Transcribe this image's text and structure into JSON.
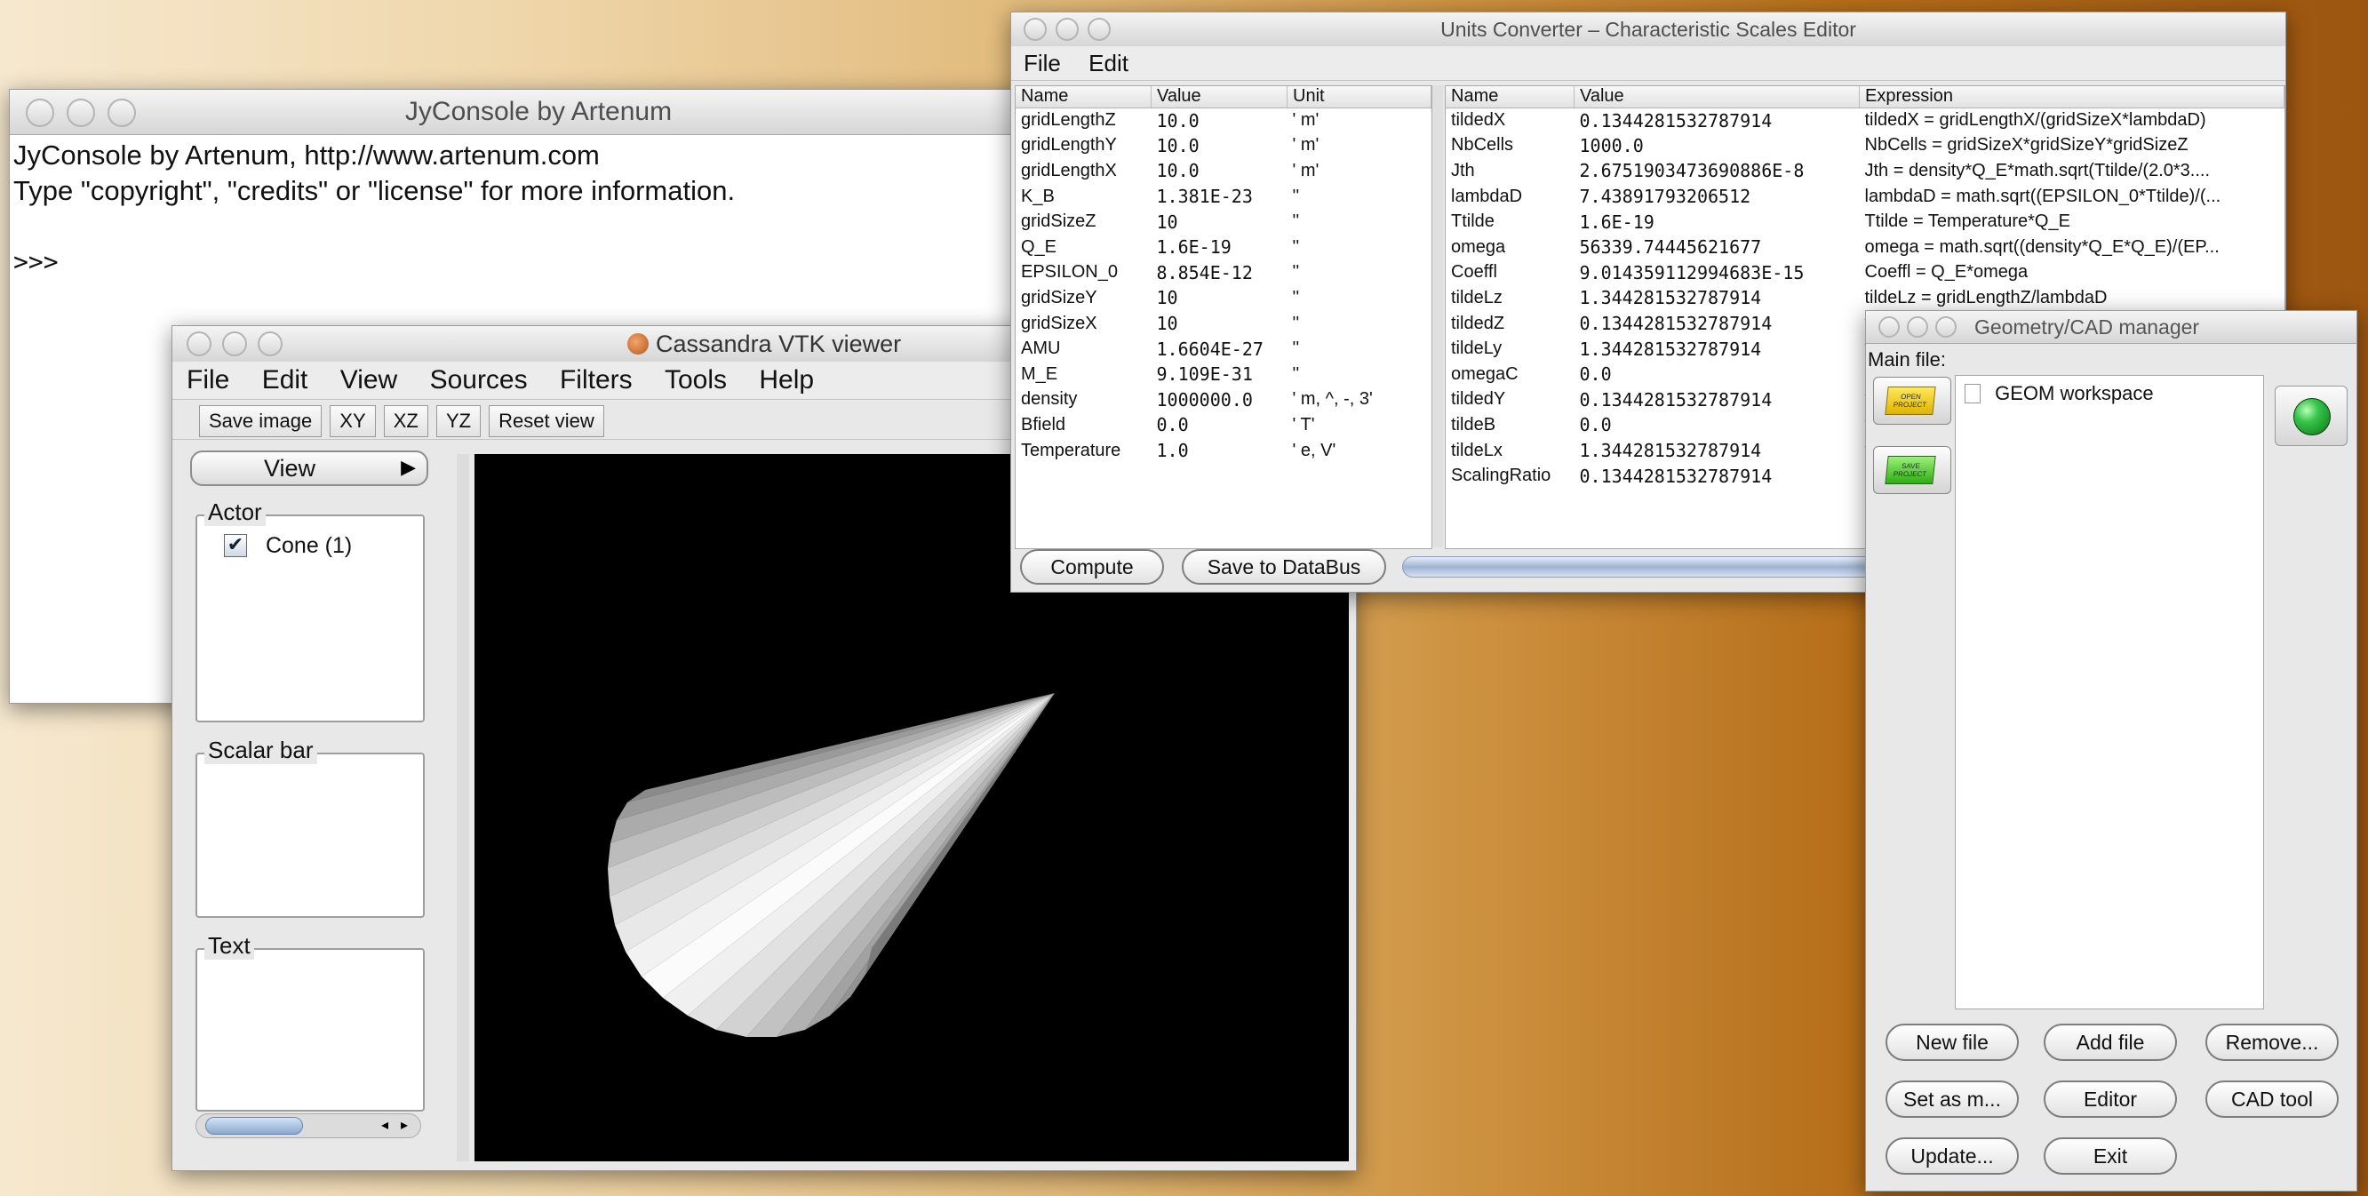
{
  "console": {
    "title": "JyConsole by Artenum",
    "line1": "JyConsole by Artenum, http://www.artenum.com",
    "line2": "Type \"copyright\", \"credits\" or \"license\" for more information.",
    "prompt": ">>>"
  },
  "vtk": {
    "title": "Cassandra VTK viewer",
    "menu": [
      "File",
      "Edit",
      "View",
      "Sources",
      "Filters",
      "Tools",
      "Help"
    ],
    "toolbar": [
      "Save image",
      "XY",
      "XZ",
      "YZ",
      "Reset view"
    ],
    "view_button": "View",
    "actor_label": "Actor",
    "actor_item": "Cone (1)",
    "actor_checked": true,
    "scalar_bar_label": "Scalar bar",
    "text_label": "Text"
  },
  "units": {
    "title": "Units Converter – Characteristic Scales Editor",
    "menu": [
      "File",
      "Edit"
    ],
    "left_headers": [
      "Name",
      "Value",
      "Unit"
    ],
    "left_rows": [
      [
        "gridLengthZ",
        "10.0",
        "' m'"
      ],
      [
        "gridLengthY",
        "10.0",
        "' m'"
      ],
      [
        "gridLengthX",
        "10.0",
        "' m'"
      ],
      [
        "K_B",
        "1.381E-23",
        "''"
      ],
      [
        "gridSizeZ",
        "10",
        "''"
      ],
      [
        "Q_E",
        "1.6E-19",
        "''"
      ],
      [
        "EPSILON_0",
        "8.854E-12",
        "''"
      ],
      [
        "gridSizeY",
        "10",
        "''"
      ],
      [
        "gridSizeX",
        "10",
        "''"
      ],
      [
        "AMU",
        "1.6604E-27",
        "''"
      ],
      [
        "M_E",
        "9.109E-31",
        "''"
      ],
      [
        "density",
        "1000000.0",
        "' m, ^, -, 3'"
      ],
      [
        "Bfield",
        "0.0",
        "' T'"
      ],
      [
        "Temperature",
        "1.0",
        "' e, V'"
      ]
    ],
    "right_headers": [
      "Name",
      "Value",
      "Expression"
    ],
    "right_rows": [
      [
        "tildedX",
        "0.1344281532787914",
        "tildedX = gridLengthX/(gridSizeX*lambdaD)"
      ],
      [
        "NbCells",
        "1000.0",
        "NbCells = gridSizeX*gridSizeY*gridSizeZ"
      ],
      [
        "Jth",
        "2.6751903473690886E-8",
        "Jth = density*Q_E*math.sqrt(Ttilde/(2.0*3...."
      ],
      [
        "lambdaD",
        "7.43891793206512",
        "lambdaD = math.sqrt((EPSILON_0*Ttilde)/(..."
      ],
      [
        "Ttilde",
        "1.6E-19",
        "Ttilde = Temperature*Q_E"
      ],
      [
        "omega",
        "56339.74445621677",
        "omega = math.sqrt((density*Q_E*Q_E)/(EP..."
      ],
      [
        "Coeffl",
        "9.014359112994683E-15",
        "Coeffl = Q_E*omega"
      ],
      [
        "tildeLz",
        "1.344281532787914",
        "tildeLz = gridLengthZ/lambdaD"
      ],
      [
        "tildedZ",
        "0.1344281532787914",
        "ti"
      ],
      [
        "tildeLy",
        "1.344281532787914",
        "ti"
      ],
      [
        "omegaC",
        "0.0",
        "o"
      ],
      [
        "tildedY",
        "0.1344281532787914",
        "ti"
      ],
      [
        "tildeB",
        "0.0",
        "ti"
      ],
      [
        "tildeLx",
        "1.344281532787914",
        "ti"
      ],
      [
        "ScalingRatio",
        "0.1344281532787914",
        "Sc"
      ]
    ],
    "compute_label": "Compute",
    "save_label": "Save to DataBus"
  },
  "geom": {
    "title": "Geometry/CAD manager",
    "main_file_label": "Main file:",
    "open_project_label": "OPEN PROJECT",
    "save_project_label": "SAVE PROJECT",
    "workspace_item": "GEOM workspace",
    "status_color": "#1e9a2e",
    "buttons": [
      [
        "New file",
        "Add file",
        "Remove..."
      ],
      [
        "Set as m...",
        "Editor",
        "CAD tool"
      ],
      [
        "Update...",
        "Exit"
      ]
    ]
  }
}
